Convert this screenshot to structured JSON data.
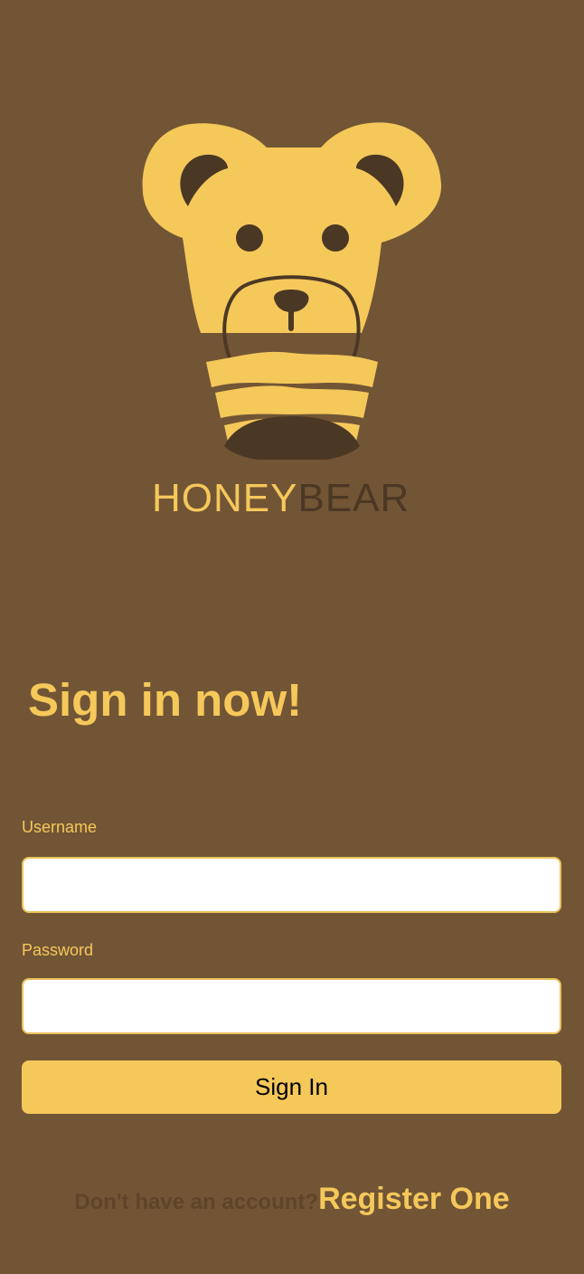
{
  "logo": {
    "icon": "bear-head-icon",
    "wordmark_first": "HONEY",
    "wordmark_second": "BEAR",
    "colors": {
      "primary": "#F5C85A",
      "dark": "#4B3824"
    }
  },
  "heading": "Sign in now!",
  "form": {
    "username_label": "Username",
    "username_value": "",
    "password_label": "Password",
    "password_value": "",
    "submit_label": "Sign In"
  },
  "footer": {
    "prompt": "Don't have an account?",
    "link_label": "Register One"
  },
  "colors": {
    "background": "#725535",
    "accent": "#F5C85A",
    "muted_text": "#5E4429",
    "input_background": "#FFFFFF"
  }
}
